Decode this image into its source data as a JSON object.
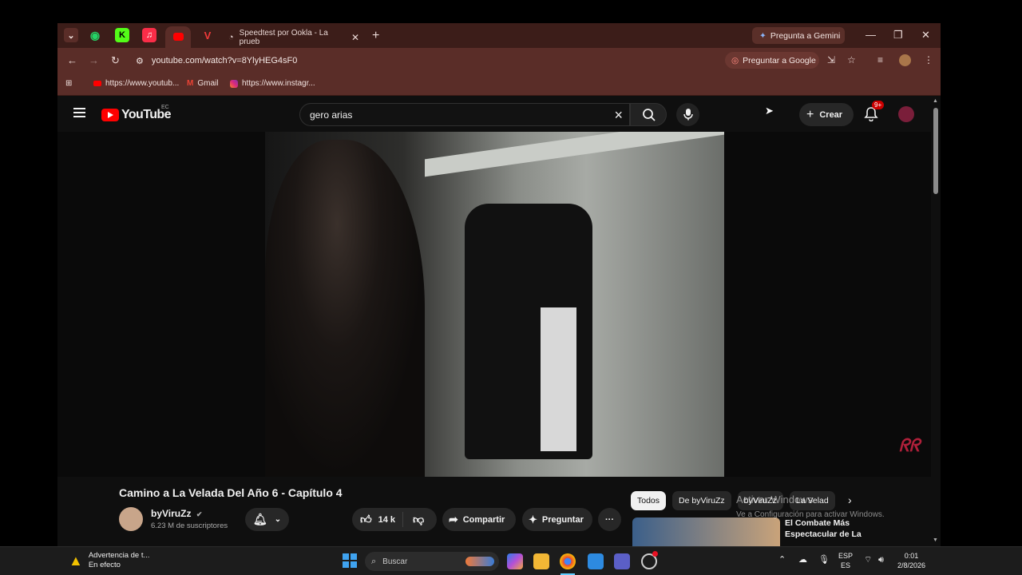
{
  "browser": {
    "tabs": [
      {
        "icon": "whatsapp-icon",
        "color": "#25d366"
      },
      {
        "icon": "kick-icon",
        "color": "#53fc18"
      },
      {
        "icon": "music-icon",
        "color": "#fa2d48"
      },
      {
        "icon": "youtube-icon",
        "color": "#ff0000",
        "active": true
      },
      {
        "icon": "vivaldi-icon",
        "color": "#ef3939"
      },
      {
        "icon": "speedtest-icon",
        "label": "Speedtest por Ookla - La prueb"
      }
    ],
    "gemini_button": "Pregunta a Gemini",
    "url": "youtube.com/watch?v=8YlyHEG4sF0",
    "ask_google": "Preguntar a Google",
    "bookmarks": [
      {
        "icon": "youtube-icon",
        "label": "https://www.youtub..."
      },
      {
        "icon": "gmail-icon",
        "label": "Gmail"
      },
      {
        "icon": "instagram-icon",
        "label": "https://www.instagr..."
      }
    ]
  },
  "youtube": {
    "logo_text": "YouTube",
    "country_code": "EC",
    "search_value": "gero arias",
    "create_label": "Crear",
    "notifications_badge": "9+",
    "accent": "#ff0000"
  },
  "video": {
    "title": "Camino a La Velada Del Año 6 - Capítulo 4",
    "channel_name": "byViruZz",
    "channel_verified": "✔",
    "subscribers": "6.23 M de suscriptores",
    "likes": "14 k",
    "share_label": "Compartir",
    "ask_label": "Preguntar",
    "more_label": "···"
  },
  "recommendations": {
    "chips": [
      "Todos",
      "De byViruZz",
      "byViruZz",
      "La Velad"
    ],
    "first_title": "El Combate Más Espectacular de La"
  },
  "windows_activation": {
    "line1": "Activar Windows",
    "line2": "Ve a Configuración para activar Windows."
  },
  "taskbar": {
    "weather_title": "Advertencia de t...",
    "weather_status": "En efecto",
    "search_placeholder": "Buscar",
    "lang_top": "ESP",
    "lang_bottom": "ES",
    "time": "0:01",
    "date": "2/8/2026"
  }
}
